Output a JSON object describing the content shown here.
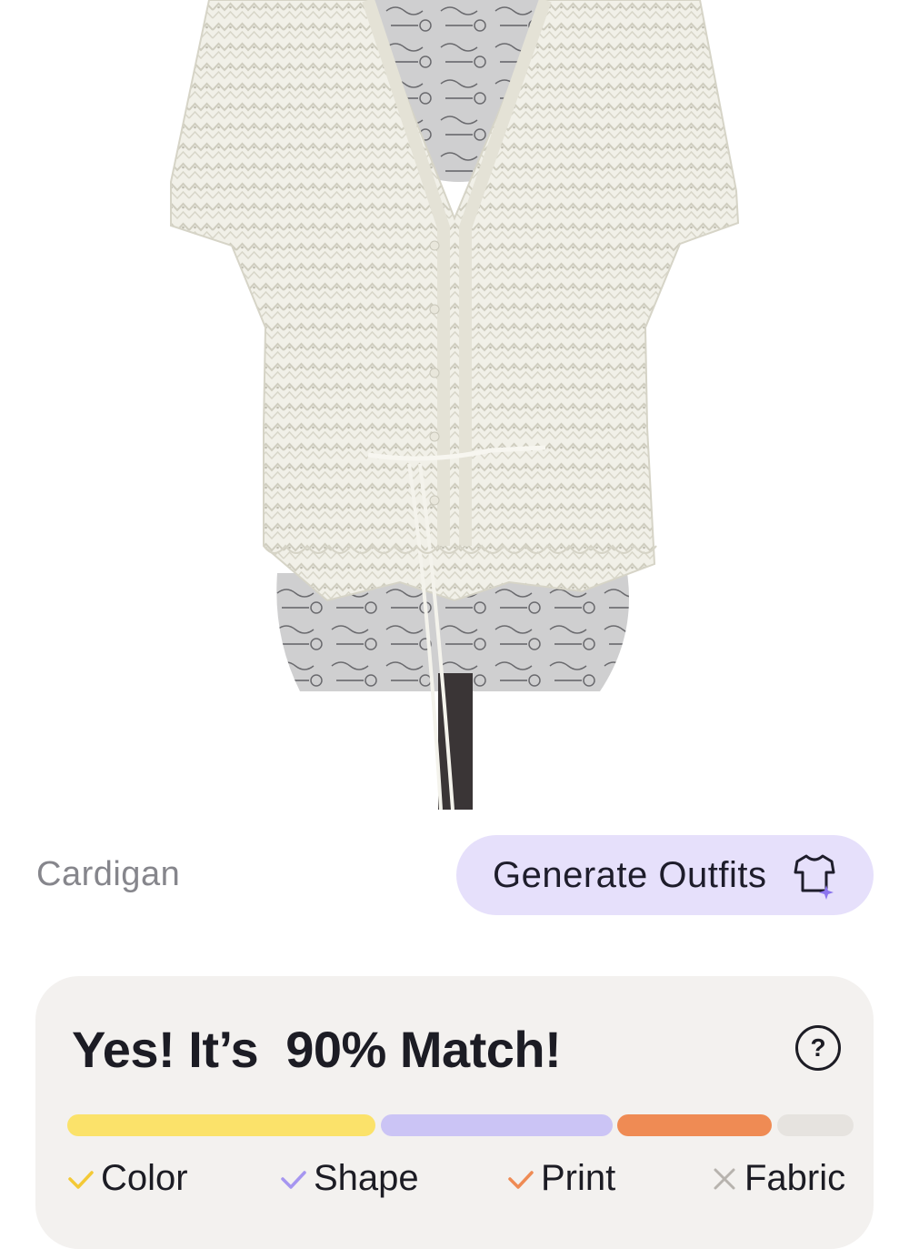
{
  "item": {
    "category": "Cardigan",
    "image_description": "White short-sleeve pointelle knit cardigan with tie waist on a printed dress form"
  },
  "actions": {
    "generate_outfits_label": "Generate Outfits",
    "generate_icon": "tshirt-sparkle-icon",
    "help_icon": "question-circle-icon",
    "help_label": "?"
  },
  "match": {
    "title": "Yes! It’s  90% Match!",
    "percent": 90,
    "segments": [
      {
        "name": "Color",
        "fraction": 0.4,
        "color": "#fbe26a"
      },
      {
        "name": "Shape",
        "fraction": 0.3,
        "color": "#cbc4f5"
      },
      {
        "name": "Print",
        "fraction": 0.2,
        "color": "#ef8b54"
      },
      {
        "name": "Fabric",
        "fraction": 0.1,
        "color": "#e6e3df"
      }
    ],
    "attributes": [
      {
        "label": "Color",
        "status": "check",
        "icon": "check-icon",
        "color": "#f3c936"
      },
      {
        "label": "Shape",
        "status": "check",
        "icon": "check-icon",
        "color": "#a696f0"
      },
      {
        "label": "Print",
        "status": "check",
        "icon": "check-icon",
        "color": "#ef8b54"
      },
      {
        "label": "Fabric",
        "status": "cross",
        "icon": "cross-icon",
        "color": "#b7b3ae"
      }
    ]
  }
}
